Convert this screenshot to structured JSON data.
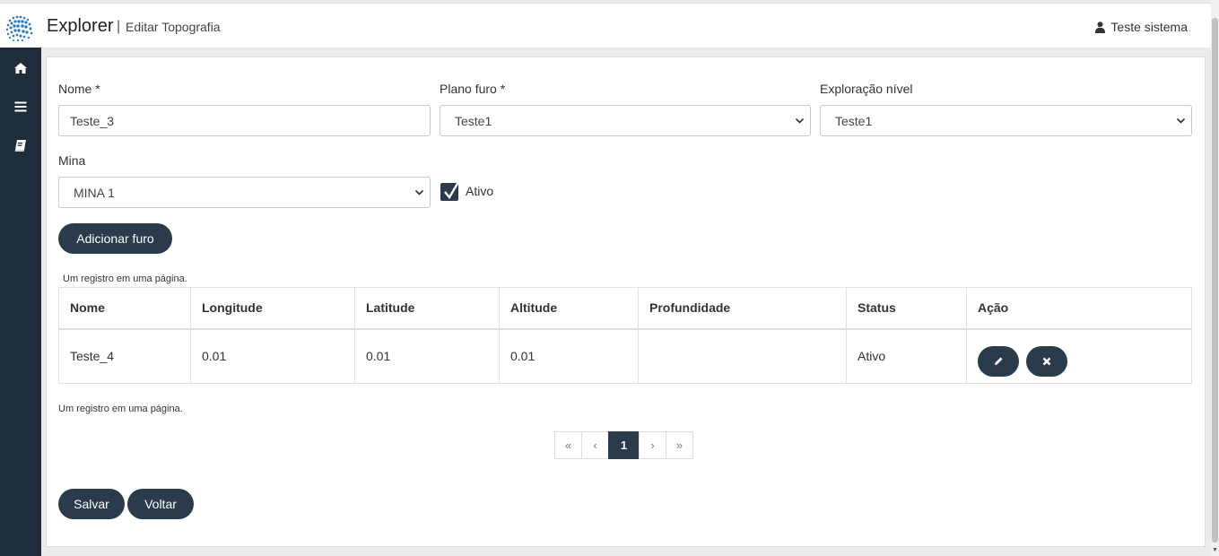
{
  "header": {
    "app_title": "Explorer",
    "separator": "|",
    "page_title": "Editar Topografia",
    "user_name": "Teste sistema"
  },
  "sidebar": {
    "items": [
      {
        "icon": "home-icon"
      },
      {
        "icon": "menu-icon"
      },
      {
        "icon": "book-icon"
      }
    ]
  },
  "form": {
    "nome_label": "Nome *",
    "nome_value": "Teste_3",
    "plano_label": "Plano furo *",
    "plano_value": "Teste1",
    "exploracao_label": "Exploração nível",
    "exploracao_value": "Teste1",
    "mina_label": "Mina",
    "mina_value": "MINA 1",
    "ativo_label": "Ativo",
    "ativo_checked": true,
    "add_button": "Adicionar furo"
  },
  "table": {
    "info_top": "Um registro em uma página.",
    "info_bottom": "Um registro em uma página.",
    "columns": [
      "Nome",
      "Longitude",
      "Latitude",
      "Altitude",
      "Profundidade",
      "Status",
      "Ação"
    ],
    "rows": [
      {
        "nome": "Teste_4",
        "longitude": "0.01",
        "latitude": "0.01",
        "altitude": "0.01",
        "profundidade": "",
        "status": "Ativo"
      }
    ]
  },
  "pagination": {
    "first": "«",
    "prev": "‹",
    "current": "1",
    "next": "›",
    "last": "»"
  },
  "footer": {
    "save_button": "Salvar",
    "back_button": "Voltar"
  },
  "colors": {
    "sidebar": "#1f2d3a",
    "primary": "#2a3b4c"
  }
}
